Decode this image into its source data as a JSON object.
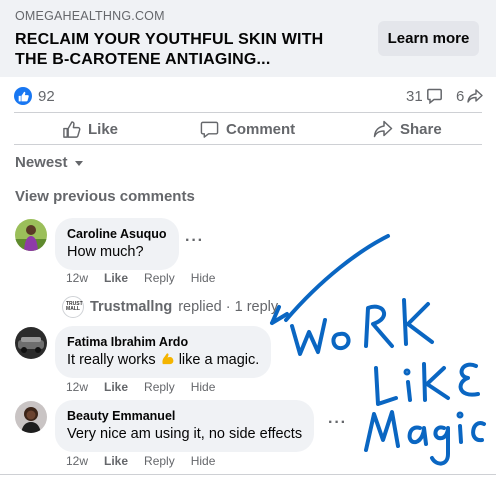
{
  "ad": {
    "domain": "OMEGAHEALTHNG.COM",
    "title": "RECLAIM YOUR YOUTHFUL SKIN WITH THE B-CAROTENE ANTIAGING...",
    "cta_label": "Learn more"
  },
  "stats": {
    "likes": "92",
    "comments": "31",
    "shares": "6"
  },
  "actions": {
    "like": "Like",
    "comment": "Comment",
    "share": "Share"
  },
  "sort_label": "Newest",
  "view_previous": "View previous comments",
  "comments": [
    {
      "name": "Caroline Asuquo",
      "text": "How much?",
      "time": "12w",
      "like": "Like",
      "reply": "Reply",
      "hide": "Hide"
    },
    {
      "name": "Fatima Ibrahim Ardo",
      "text_before": "It really works",
      "text_after": "like a magic.",
      "time": "12w",
      "like": "Like",
      "reply": "Reply",
      "hide": "Hide"
    },
    {
      "name": "Beauty Emmanuel",
      "text": "Very nice am using it, no side effects",
      "time": "12w",
      "like": "Like",
      "reply": "Reply",
      "hide": "Hide"
    }
  ],
  "reply_summary": {
    "name": "Trustmallng",
    "text": "replied · 1 reply",
    "avatar_text": "TRUST MALL"
  },
  "annotation": {
    "text": "WoRK LiKE Magic",
    "color": "#0a66c2"
  },
  "colors": {
    "accent": "#1877f2",
    "secondary_text": "#65676b",
    "bubble": "#f0f2f5"
  }
}
